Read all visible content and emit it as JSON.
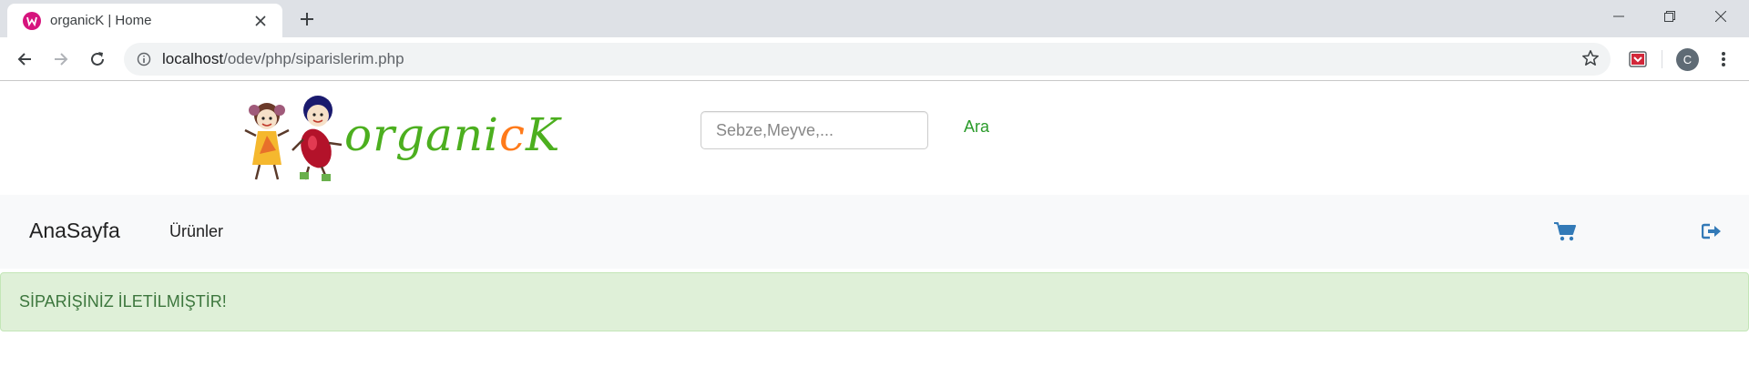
{
  "browser": {
    "tab_title": "organicK | Home",
    "url_host": "localhost",
    "url_path": "/odev/php/siparislerim.php",
    "profile_initial": "C"
  },
  "header": {
    "logo_text_1": "organi",
    "logo_text_2": "c",
    "logo_text_3": "K",
    "search_placeholder": "Sebze,Meyve,...",
    "search_button": "Ara"
  },
  "navbar": {
    "brand": "AnaSayfa",
    "products_link": "Ürünler",
    "cart_icon": "shopping-cart-icon",
    "logout_icon": "logout-icon"
  },
  "alert": {
    "message": "SİPARİŞİNİZ İLETİLMİŞTİR!"
  },
  "colors": {
    "search_button": "#2b9b2b",
    "icon_blue": "#337ab7",
    "alert_bg": "#dff0d8",
    "alert_text": "#3c763d"
  }
}
